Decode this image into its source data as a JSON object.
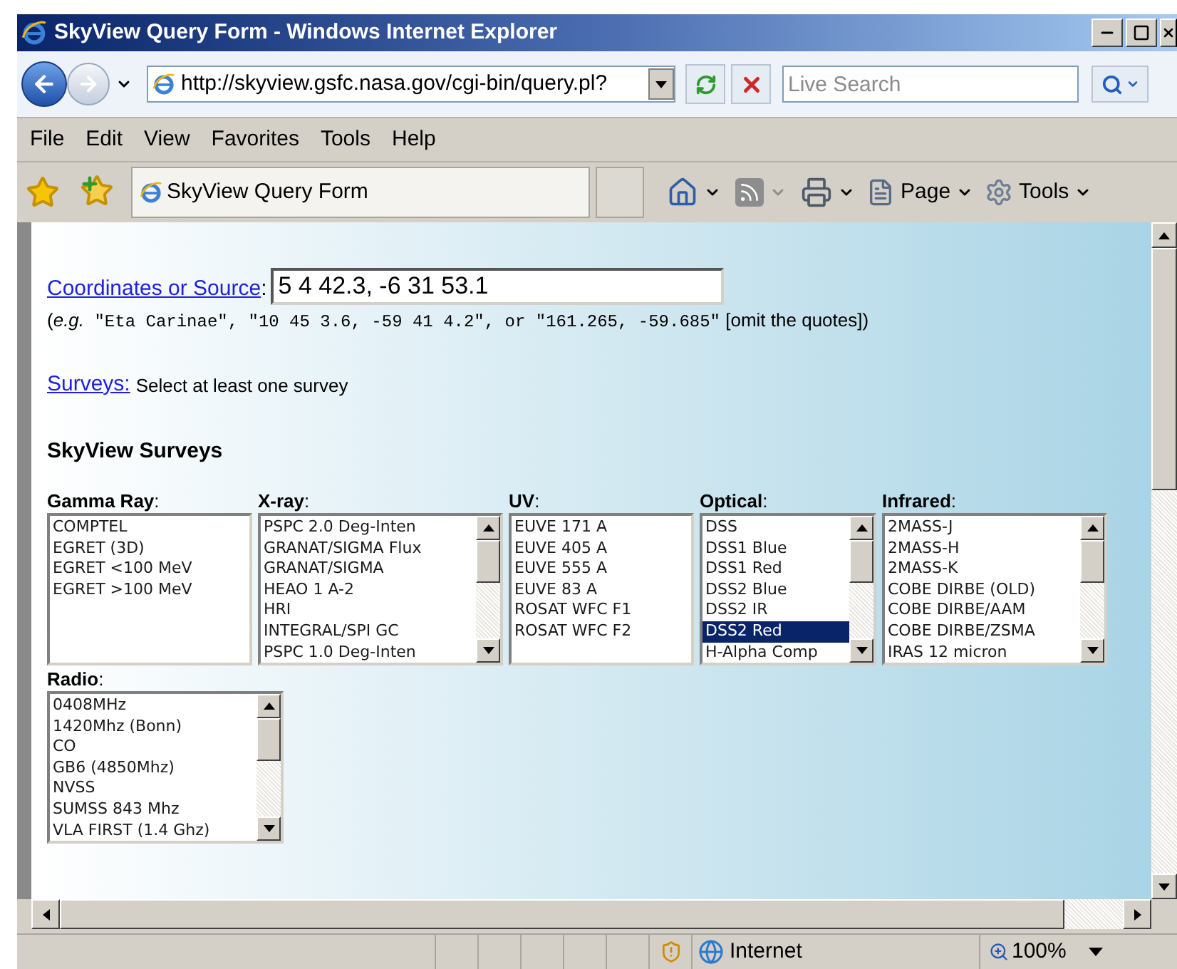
{
  "window": {
    "title": "SkyView Query Form - Windows Internet Explorer"
  },
  "address_bar": {
    "url": "http://skyview.gsfc.nasa.gov/cgi-bin/query.pl?",
    "search_placeholder": "Live Search"
  },
  "menu": [
    "File",
    "Edit",
    "View",
    "Favorites",
    "Tools",
    "Help"
  ],
  "favorites_bar": {
    "tab_title": "SkyView Query Form",
    "commands": [
      "Page",
      "Tools"
    ]
  },
  "form": {
    "coordinates_link": "Coordinates or Source",
    "coordinates_colon": ":",
    "coordinates_value": "5 4 42.3, -6 31 53.1",
    "example": [
      {
        "kind": "text",
        "text": "("
      },
      {
        "kind": "italic",
        "text": "e.g."
      },
      {
        "kind": "code",
        "text": " \"Eta Carinae\", \"10 45 3.6, -59 41 4.2\", or \"161.265, -59.685\""
      },
      {
        "kind": "text",
        "text": " [omit the quotes])"
      }
    ],
    "surveys_link": "Surveys:",
    "surveys_hint": "Select at least one survey",
    "heading": "SkyView Surveys",
    "survey_groups": [
      {
        "label": "**Gamma Ray**:",
        "items": [
          {
            "text": "COMPTEL",
            "selected": false
          },
          {
            "text": "EGRET (3D)",
            "selected": false
          },
          {
            "text": "EGRET <100 MeV",
            "selected": false
          },
          {
            "text": "EGRET >100 MeV",
            "selected": false
          }
        ]
      },
      {
        "label": "**X-ray**:",
        "items": [
          {
            "text": "PSPC 2.0 Deg-Inten",
            "selected": false
          },
          {
            "text": "GRANAT/SIGMA Flux",
            "selected": false
          },
          {
            "text": "GRANAT/SIGMA",
            "selected": false
          },
          {
            "text": "HEAO 1 A-2",
            "selected": false
          },
          {
            "text": "HRI",
            "selected": false
          },
          {
            "text": "INTEGRAL/SPI GC",
            "selected": false
          },
          {
            "text": "PSPC 1.0 Deg-Inten",
            "selected": false
          }
        ]
      },
      {
        "label": "**UV**:",
        "items": [
          {
            "text": "EUVE 171 A",
            "selected": false
          },
          {
            "text": "EUVE 405 A",
            "selected": false
          },
          {
            "text": "EUVE 555 A",
            "selected": false
          },
          {
            "text": "EUVE 83 A",
            "selected": false
          },
          {
            "text": "ROSAT WFC F1",
            "selected": false
          },
          {
            "text": "ROSAT WFC F2",
            "selected": false
          }
        ]
      },
      {
        "label": "**Optical**:",
        "items": [
          {
            "text": "DSS",
            "selected": false
          },
          {
            "text": "DSS1 Blue",
            "selected": false
          },
          {
            "text": "DSS1 Red",
            "selected": false
          },
          {
            "text": "DSS2 Blue",
            "selected": false
          },
          {
            "text": "DSS2 IR",
            "selected": false
          },
          {
            "text": "DSS2 Red",
            "selected": true
          },
          {
            "text": "H-Alpha Comp",
            "selected": false
          }
        ]
      },
      {
        "label": "**Infrared**:",
        "items": [
          {
            "text": "2MASS-J",
            "selected": false
          },
          {
            "text": "2MASS-H",
            "selected": false
          },
          {
            "text": "2MASS-K",
            "selected": false
          },
          {
            "text": "COBE DIRBE (OLD)",
            "selected": false
          },
          {
            "text": "COBE DIRBE/AAM",
            "selected": false
          },
          {
            "text": "COBE DIRBE/ZSMA",
            "selected": false
          },
          {
            "text": "IRAS 12 micron",
            "selected": false
          }
        ]
      },
      {
        "label": "**Radio**:",
        "items": [
          {
            "text": "0408MHz",
            "selected": false
          },
          {
            "text": "1420Mhz (Bonn)",
            "selected": false
          },
          {
            "text": "CO",
            "selected": false
          },
          {
            "text": "GB6 (4850Mhz)",
            "selected": false
          },
          {
            "text": "NVSS",
            "selected": false
          },
          {
            "text": "SUMSS 843 Mhz",
            "selected": false
          },
          {
            "text": "VLA FIRST (1.4 Ghz)",
            "selected": false
          }
        ]
      }
    ]
  },
  "status_bar": {
    "zone": "Internet",
    "zoom": "100%"
  }
}
